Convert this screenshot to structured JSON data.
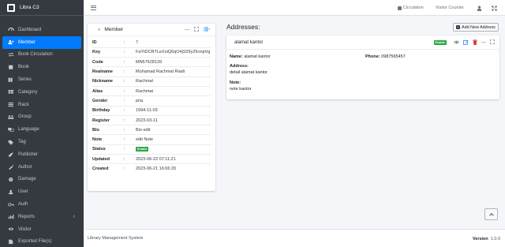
{
  "brand": {
    "name": "Libra C3"
  },
  "sidebar": {
    "items": [
      {
        "label": "Dashboard",
        "icon": "dashboard-icon"
      },
      {
        "label": "Member",
        "icon": "member-icon",
        "active": true
      },
      {
        "label": "Book Circulation",
        "icon": "circulation-icon"
      },
      {
        "label": "Book",
        "icon": "book-icon"
      },
      {
        "label": "Series",
        "icon": "series-icon"
      },
      {
        "label": "Category",
        "icon": "category-icon"
      },
      {
        "label": "Rack",
        "icon": "rack-icon"
      },
      {
        "label": "Group",
        "icon": "group-icon"
      },
      {
        "label": "Language",
        "icon": "language-icon"
      },
      {
        "label": "Tag",
        "icon": "tag-icon"
      },
      {
        "label": "Publisher",
        "icon": "publisher-icon"
      },
      {
        "label": "Author",
        "icon": "author-icon"
      },
      {
        "label": "Damage",
        "icon": "damage-icon"
      },
      {
        "label": "User",
        "icon": "user-icon"
      },
      {
        "label": "Auth",
        "icon": "auth-icon"
      },
      {
        "label": "Reports",
        "icon": "reports-icon",
        "has_submenu": true
      },
      {
        "label": "Visitor",
        "icon": "visitor-icon"
      },
      {
        "label": "Exported File(s)",
        "icon": "exported-files-icon"
      }
    ]
  },
  "topbar": {
    "circulation_label": "Circulation",
    "visitor_counter_label": "Visitor Counter"
  },
  "member": {
    "title": "Member",
    "fields": [
      {
        "key": "ID",
        "value": "7"
      },
      {
        "key": "Key",
        "value": "FaYtDCRTLeXoiQ6qO4jS29yZfcmpVg"
      },
      {
        "key": "Code",
        "value": "MN57628139"
      },
      {
        "key": "Realname",
        "value": "Muhamad Rachmat Riadi"
      },
      {
        "key": "Nickname",
        "value": "Rachmat"
      },
      {
        "key": "Alias",
        "value": "Rachmat"
      },
      {
        "key": "Gender",
        "value": "pria"
      },
      {
        "key": "Birthday",
        "value": "1994-11-03"
      },
      {
        "key": "Register",
        "value": "2023-03-11"
      },
      {
        "key": "Bio",
        "value": "Bio edit"
      },
      {
        "key": "Note",
        "value": "edit Note"
      },
      {
        "key": "Status",
        "value": "Enable",
        "badge": true
      },
      {
        "key": "Updated",
        "value": "2023-06-22 07:11:21"
      },
      {
        "key": "Created",
        "value": "2023-06-21 16:06:20"
      }
    ]
  },
  "addresses": {
    "title": "Addresses:",
    "add_label": "Add New Address",
    "items": [
      {
        "name": "alamat kantor",
        "status": "Enable",
        "name_label": "Name:",
        "name_value": "alamat kantor",
        "phone_label": "Phone:",
        "phone_value": "0987565457",
        "address_label": "Address:",
        "address_value": "detail alamat kantor",
        "note_label": "Note:",
        "note_value": "note kantor"
      }
    ]
  },
  "footer": {
    "app_name": "Library Management System",
    "version_label": "Version",
    "version_value": "1.0.0"
  },
  "colors": {
    "sidebar_bg": "#343a40",
    "active": "#007bff",
    "enable_badge": "#28a745",
    "delete": "#dc3545"
  }
}
